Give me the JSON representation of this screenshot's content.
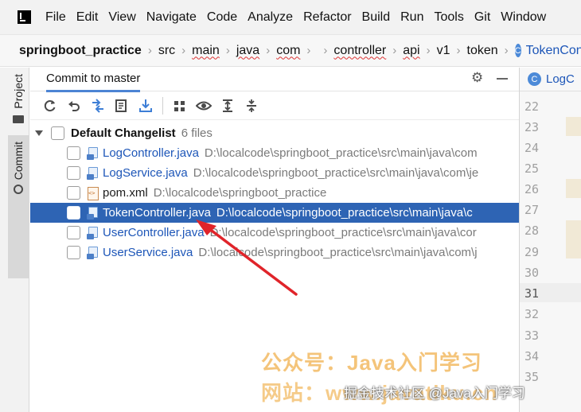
{
  "menu": [
    "File",
    "Edit",
    "View",
    "Navigate",
    "Code",
    "Analyze",
    "Refactor",
    "Build",
    "Run",
    "Tools",
    "Git",
    "Window"
  ],
  "breadcrumb": {
    "project": "springboot_practice",
    "parts": [
      "src",
      "main",
      "java",
      "com"
    ],
    "parts_after": [
      "controller",
      "api",
      "v1",
      "token"
    ],
    "class": "TokenController"
  },
  "tool_strip": {
    "project": "Project",
    "commit": "Commit"
  },
  "commit_panel": {
    "title": "Commit to master",
    "changelist": {
      "name": "Default Changelist",
      "count": "6 files"
    },
    "files": [
      {
        "name": "LogController.java",
        "path": "D:\\localcode\\springboot_practice\\src\\main\\java\\com",
        "type": "java",
        "selected": false
      },
      {
        "name": "LogService.java",
        "path": "D:\\localcode\\springboot_practice\\src\\main\\java\\com\\je",
        "type": "java",
        "selected": false
      },
      {
        "name": "pom.xml",
        "path": "D:\\localcode\\springboot_practice",
        "type": "xml",
        "selected": false
      },
      {
        "name": "TokenController.java",
        "path": "D:\\localcode\\springboot_practice\\src\\main\\java\\c",
        "type": "java",
        "selected": true
      },
      {
        "name": "UserController.java",
        "path": "D:\\localcode\\springboot_practice\\src\\main\\java\\cor",
        "type": "java",
        "selected": false
      },
      {
        "name": "UserService.java",
        "path": "D:\\localcode\\springboot_practice\\src\\main\\java\\com\\j",
        "type": "java",
        "selected": false
      }
    ]
  },
  "editor": {
    "tab": "LogC",
    "line_numbers": [
      "22",
      "23",
      "24",
      "25",
      "26",
      "27",
      "28",
      "29",
      "30",
      "31",
      "32",
      "33",
      "34",
      "35"
    ],
    "current_line": "31"
  },
  "watermark": {
    "line1": "公众号：Java入门学习",
    "line2": "网站：www.javatiku.cn",
    "overlay": "掘金技术社区 @Java入门学习"
  },
  "colors": {
    "selection": "#2e64b4",
    "link": "#1d56b8",
    "accent": "#4c84d4",
    "arrow": "#e0242a"
  }
}
